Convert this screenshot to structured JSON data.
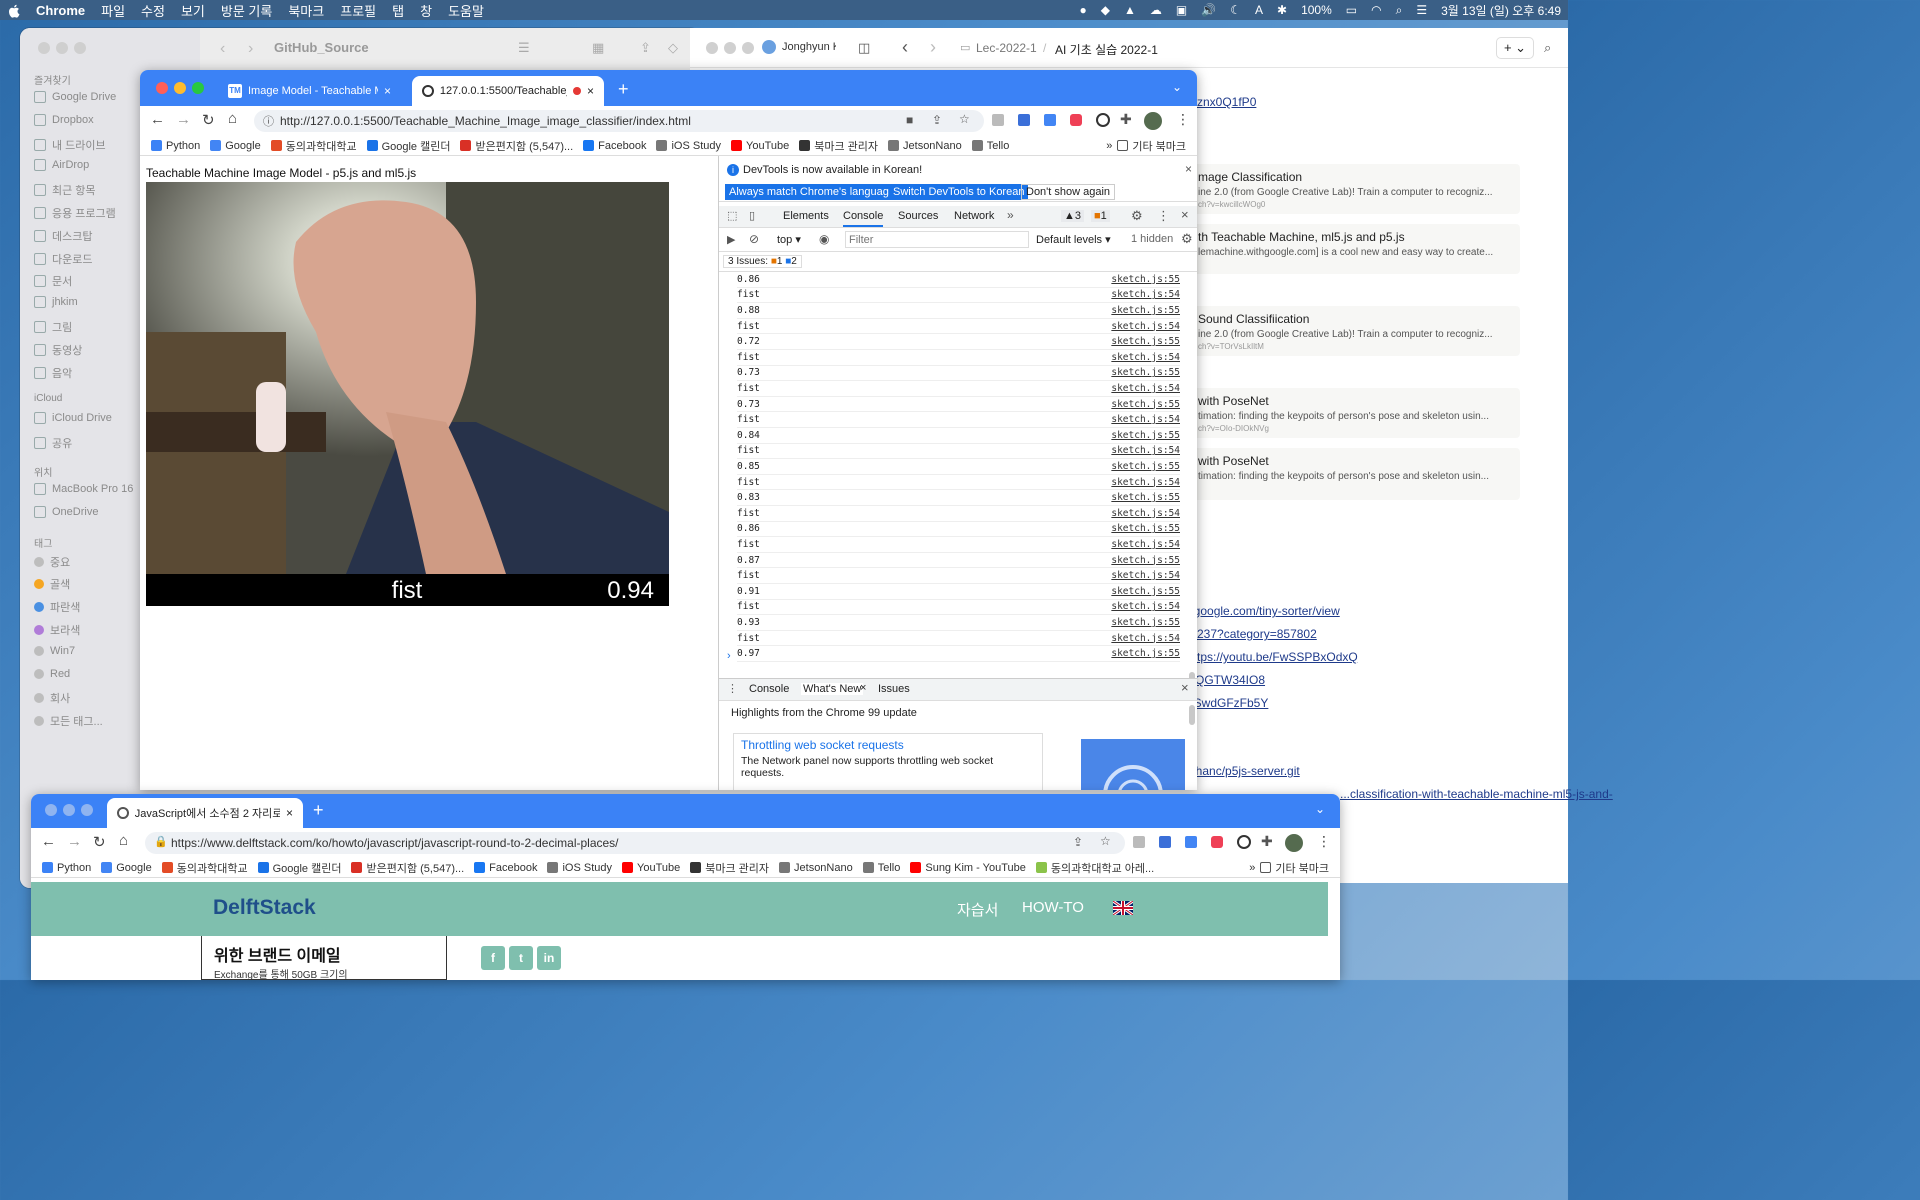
{
  "menubar": {
    "app": "Chrome",
    "items": [
      "파일",
      "수정",
      "보기",
      "방문 기록",
      "북마크",
      "프로필",
      "탭",
      "창",
      "도움말"
    ],
    "battery": "100%",
    "datetime": "3월 13일 (일) 오후 6:49"
  },
  "finder": {
    "title": "GitHub_Source",
    "favorites_header": "즐겨찾기",
    "favorites": [
      "Google Drive",
      "Dropbox",
      "내 드라이브",
      "AirDrop",
      "최근 항목",
      "응용 프로그램",
      "데스크탑",
      "다운로드",
      "문서",
      "jhkim",
      "그림",
      "동영상",
      "음악"
    ],
    "icloud_header": "iCloud",
    "icloud": [
      "iCloud Drive",
      "공유"
    ],
    "locations_header": "위치",
    "locations": [
      "MacBook Pro 16",
      "OneDrive"
    ],
    "tags_header": "태그",
    "tags": [
      {
        "label": "중요",
        "color": "#bdbdbd"
      },
      {
        "label": "골색",
        "color": "#f5a623"
      },
      {
        "label": "파란색",
        "color": "#4a90e2"
      },
      {
        "label": "보라색",
        "color": "#b07cd8"
      },
      {
        "label": "Win7",
        "color": "#bdbdbd"
      },
      {
        "label": "Red",
        "color": "#bdbdbd"
      },
      {
        "label": "회사",
        "color": "#bdbdbd"
      },
      {
        "label": "모든 태그...",
        "color": "#bdbdbd"
      }
    ]
  },
  "notion": {
    "tab_label": "Jonghyun K",
    "breadcrumb_parent": "Lec-2022-1",
    "breadcrumb_current": "AI 기초 실습 2022-1",
    "top_link": "mznx0Q1fP0",
    "cards": [
      {
        "title": "mage Classification",
        "desc": "ine 2.0 (from Google Creative Lab)! Train a computer to recogniz...",
        "url": "ch?v=kwcillcWOg0"
      },
      {
        "title": "th Teachable Machine, ml5.js and p5.js",
        "desc": "lemachine.withgoogle.com] is a cool new and easy way to create...",
        "url": ""
      },
      {
        "title": "Sound Classifiication",
        "desc": "ine 2.0 (from Google Creative Lab)! Train a computer to recogniz...",
        "url": "ch?v=TOrVsLkIltM"
      },
      {
        "title": "with PoseNet",
        "desc": "timation: finding the keypoits of person's pose and skeleton usin...",
        "url": "ch?v=OIo-DIOkNVg"
      },
      {
        "title": "with PoseNet",
        "desc": "timation: finding the keypoits of person's pose and skeleton usin...",
        "url": ""
      }
    ],
    "links": [
      "ngoogle.com/tiny-sorter/view",
      "/2237?category=857802",
      "https://youtu.be/FwSSPBxOdxQ",
      "SQGTW34IO8",
      "9SwdGFzFb5Y",
      "ishanc/p5js-server.git",
      "...classification-with-teachable-machine-ml5-js-and-"
    ]
  },
  "chrome1": {
    "tabs": [
      {
        "label": "Image Model - Teachable M",
        "active": false
      },
      {
        "label": "127.0.0.1:5500/Teachable_",
        "active": true
      }
    ],
    "url": "http://127.0.0.1:5500/Teachable_Machine_Image_image_classifier/index.html",
    "bookmarks": [
      "Python",
      "Google",
      "동의과학대학교",
      "Google 캘린더",
      "받은편지함 (5,547)...",
      "Facebook",
      "iOS Study",
      "YouTube",
      "북마크 관리자",
      "JetsonNano",
      "Tello"
    ],
    "other_bookmarks": "기타 북마크",
    "page_title": "Teachable Machine Image Model - p5.js and ml5.js",
    "prediction_label": "fist",
    "prediction_conf": "0.94",
    "devtools": {
      "banner": "DevTools is now available in Korean!",
      "btn_match": "Always match Chrome's language",
      "btn_switch": "Switch DevTools to Korean",
      "btn_dont": "Don't show again",
      "tabs": [
        "Elements",
        "Console",
        "Sources",
        "Network"
      ],
      "warn_count": "3",
      "info_count": "1",
      "context": "top",
      "filter_placeholder": "Filter",
      "levels": "Default levels",
      "hidden": "1 hidden",
      "issues": "3 Issues:",
      "issues_warn": "1",
      "issues_info": "2",
      "log": [
        {
          "msg": "0.86",
          "src": "sketch.js:55"
        },
        {
          "msg": "fist",
          "src": "sketch.js:54"
        },
        {
          "msg": "0.88",
          "src": "sketch.js:55"
        },
        {
          "msg": "fist",
          "src": "sketch.js:54"
        },
        {
          "msg": "0.72",
          "src": "sketch.js:55"
        },
        {
          "msg": "fist",
          "src": "sketch.js:54"
        },
        {
          "msg": "0.73",
          "src": "sketch.js:55"
        },
        {
          "msg": "fist",
          "src": "sketch.js:54"
        },
        {
          "msg": "0.73",
          "src": "sketch.js:55"
        },
        {
          "msg": "fist",
          "src": "sketch.js:54"
        },
        {
          "msg": "0.84",
          "src": "sketch.js:55"
        },
        {
          "msg": "fist",
          "src": "sketch.js:54"
        },
        {
          "msg": "0.85",
          "src": "sketch.js:55"
        },
        {
          "msg": "fist",
          "src": "sketch.js:54"
        },
        {
          "msg": "0.83",
          "src": "sketch.js:55"
        },
        {
          "msg": "fist",
          "src": "sketch.js:54"
        },
        {
          "msg": "0.86",
          "src": "sketch.js:55"
        },
        {
          "msg": "fist",
          "src": "sketch.js:54"
        },
        {
          "msg": "0.87",
          "src": "sketch.js:55"
        },
        {
          "msg": "fist",
          "src": "sketch.js:54"
        },
        {
          "msg": "0.91",
          "src": "sketch.js:55"
        },
        {
          "msg": "fist",
          "src": "sketch.js:54"
        },
        {
          "msg": "0.93",
          "src": "sketch.js:55"
        },
        {
          "msg": "fist",
          "src": "sketch.js:54"
        },
        {
          "msg": "0.97",
          "src": "sketch.js:55"
        }
      ],
      "drawer_tabs": [
        "Console",
        "What's New",
        "Issues"
      ],
      "highlights": "Highlights from the Chrome 99 update",
      "news_title": "Throttling web socket requests",
      "news_desc": "The Network panel now supports throttling web socket requests."
    }
  },
  "chrome2": {
    "tab_label": "JavaScript에서 소수점 2 자리로 반",
    "url": "https://www.delftstack.com/ko/howto/javascript/javascript-round-to-2-decimal-places/",
    "bookmarks": [
      "Python",
      "Google",
      "동의과학대학교",
      "Google 캘린더",
      "받은편지함 (5,547)...",
      "Facebook",
      "iOS Study",
      "YouTube",
      "북마크 관리자",
      "JetsonNano",
      "Tello",
      "Sung Kim - YouTube",
      "동의과학대학교 아레..."
    ],
    "other_bookmarks": "기타 북마크",
    "logo": "DelftStack",
    "nav_tutorials": "자습서",
    "nav_howto": "HOW-TO",
    "ad_line1": "위한 브랜드 이메일",
    "ad_line2": "Exchange를 통해 50GB 크기의",
    "accent": "#7fbfae"
  }
}
